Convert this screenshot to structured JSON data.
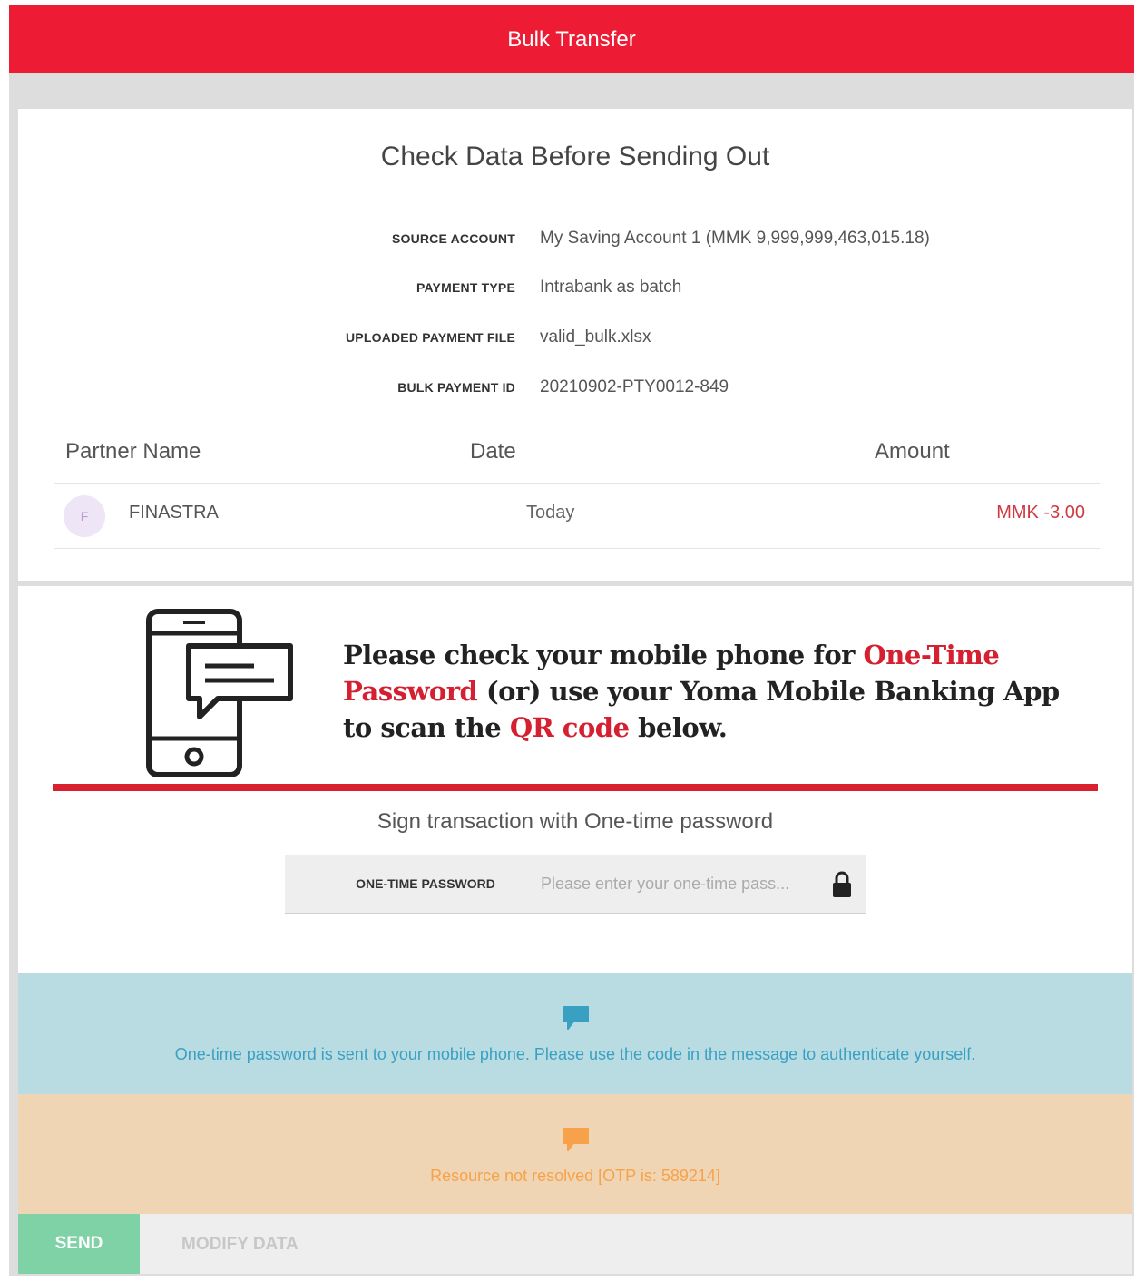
{
  "header": {
    "title": "Bulk Transfer"
  },
  "summary": {
    "title": "Check Data Before Sending Out",
    "fields": [
      {
        "label": "SOURCE ACCOUNT",
        "value": "My Saving Account 1 (MMK 9,999,999,463,015.18)"
      },
      {
        "label": "PAYMENT TYPE",
        "value": "Intrabank as batch"
      },
      {
        "label": "UPLOADED PAYMENT FILE",
        "value": "valid_bulk.xlsx"
      },
      {
        "label": "BULK PAYMENT ID",
        "value": "20210902-PTY0012-849"
      }
    ],
    "table": {
      "columns": [
        "Partner Name",
        "Date",
        "Amount"
      ],
      "rows": [
        {
          "avatar": "F",
          "name": "FINASTRA",
          "date": "Today",
          "amount": "MMK -3.00"
        }
      ]
    }
  },
  "otp_banner": {
    "part1": "Please check your mobile phone for ",
    "highlight1": "One-Time Password",
    "part2": " (or) use your Yoma Mobile Banking App to scan the ",
    "highlight2": "QR code",
    "part3": " below."
  },
  "sign": {
    "title": "Sign transaction with One-time password",
    "otp_label": "ONE-TIME PASSWORD",
    "otp_placeholder": "Please enter your one-time pass...",
    "otp_value": ""
  },
  "info_message": "One-time password is sent to your mobile phone. Please use the code in the message to authenticate yourself.",
  "warning_message": "Resource not resolved [OTP is: 589214]",
  "actions": {
    "send_label": "SEND",
    "modify_label": "MODIFY DATA"
  },
  "colors": {
    "brand": "#ee1b35",
    "info_bg": "#b9dce3",
    "warn_bg": "#f0d5b4",
    "send_bg": "#7ed2a6"
  },
  "icons": {
    "phone": "phone-message-icon",
    "lock": "lock-icon",
    "info": "chat-bubble-icon",
    "warning": "chat-bubble-icon"
  }
}
